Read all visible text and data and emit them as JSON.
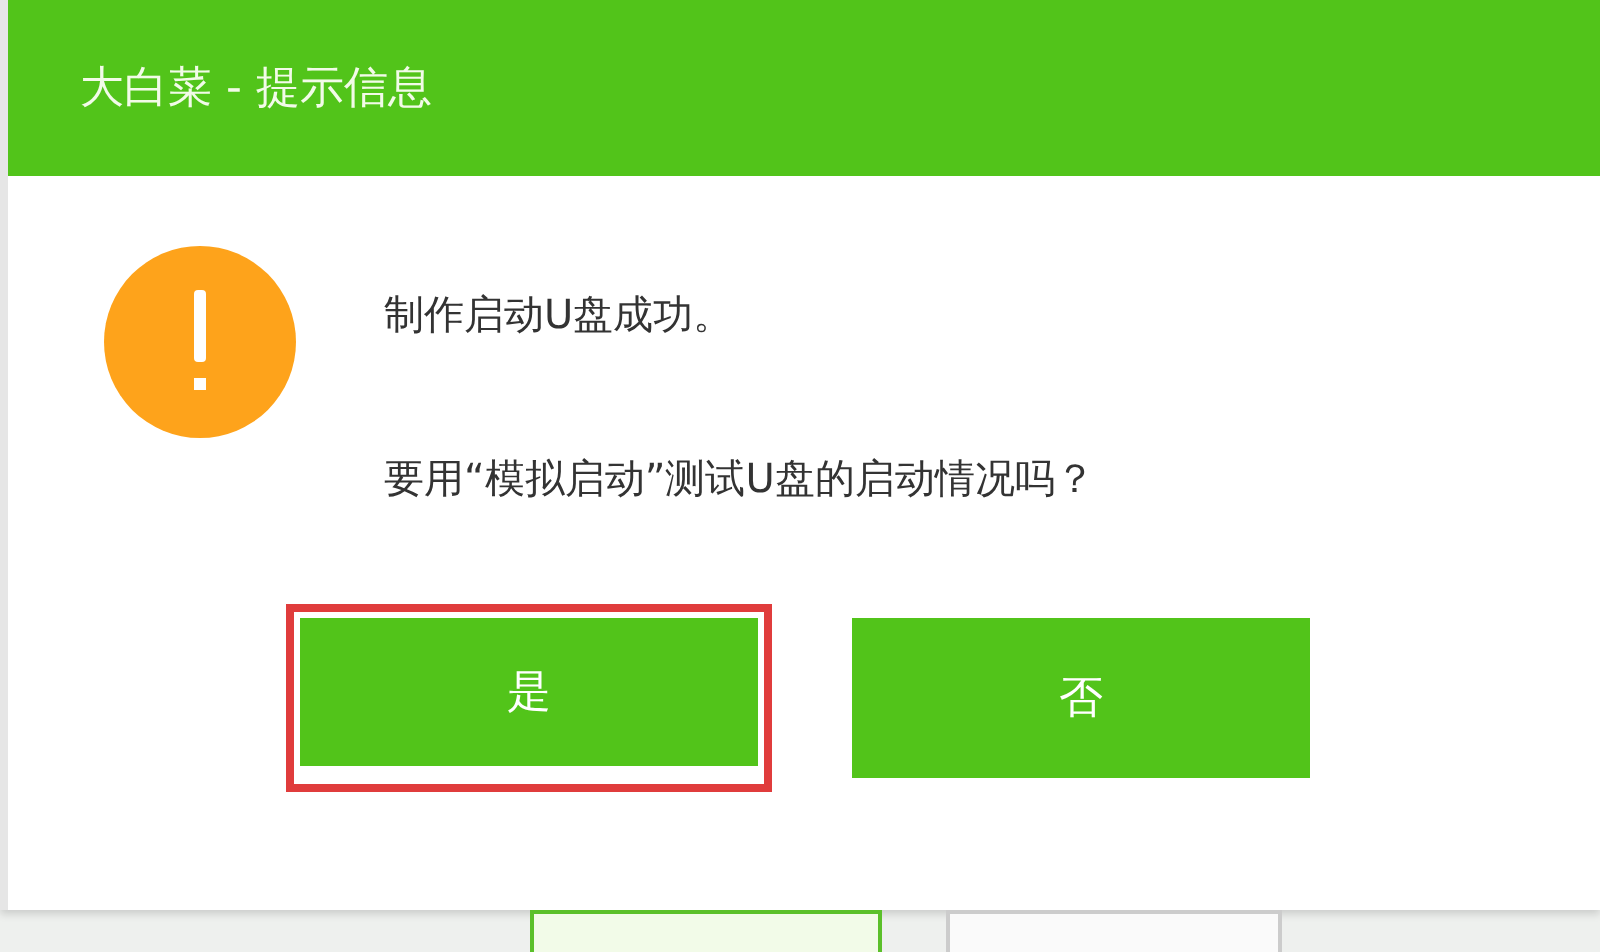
{
  "window": {
    "title": "大白菜 - 提示信息"
  },
  "message": {
    "lines": [
      "制作启动U盘成功。",
      "要用“模拟启动”测试U盘的启动情况吗？"
    ]
  },
  "buttons": [
    {
      "label": "是",
      "highlighted": true
    },
    {
      "label": "否",
      "highlighted": false
    }
  ]
}
